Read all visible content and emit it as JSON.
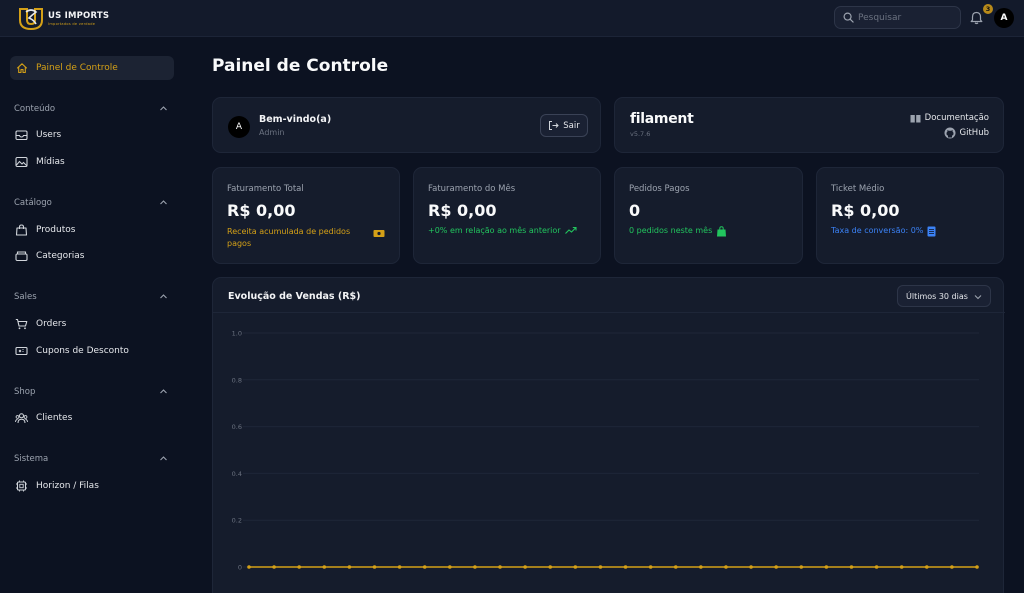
{
  "brand": {
    "name": "US IMPORTS",
    "tagline": "Importados de verdade"
  },
  "topbar": {
    "search_placeholder": "Pesquisar",
    "notification_count": "3",
    "avatar_initial": "A"
  },
  "sidebar": {
    "active": {
      "label": "Painel de Controle",
      "icon": "home-icon"
    },
    "groups": [
      {
        "label": "Conteúdo",
        "items": [
          {
            "label": "Users",
            "icon": "inbox-icon"
          },
          {
            "label": "Mídias",
            "icon": "image-icon"
          }
        ]
      },
      {
        "label": "Catálogo",
        "items": [
          {
            "label": "Produtos",
            "icon": "shopping-bag-icon"
          },
          {
            "label": "Categorias",
            "icon": "folder-icon"
          }
        ]
      },
      {
        "label": "Sales",
        "items": [
          {
            "label": "Orders",
            "icon": "cart-icon"
          },
          {
            "label": "Cupons de Desconto",
            "icon": "ticket-icon"
          }
        ]
      },
      {
        "label": "Shop",
        "items": [
          {
            "label": "Clientes",
            "icon": "users-icon"
          }
        ]
      },
      {
        "label": "Sistema",
        "items": [
          {
            "label": "Horizon / Filas",
            "icon": "cpu-chip-icon"
          }
        ]
      }
    ]
  },
  "page": {
    "title": "Painel de Controle"
  },
  "welcome": {
    "avatar_initial": "A",
    "title": "Bem-vindo(a)",
    "subtitle": "Admin",
    "logout_label": "Sair"
  },
  "filament": {
    "brand": "filament",
    "version": "v5.7.6",
    "docs_label": "Documentação",
    "github_label": "GitHub"
  },
  "stats": [
    {
      "label": "Faturamento Total",
      "value": "R$ 0,00",
      "description": "Receita acumulada de pedidos pagos",
      "color": "#d4a017",
      "icon": "banknotes-icon"
    },
    {
      "label": "Faturamento do Mês",
      "value": "R$ 0,00",
      "description": "+0% em relação ao mês anterior",
      "color": "#22c55e",
      "icon": "trending-up-icon"
    },
    {
      "label": "Pedidos Pagos",
      "value": "0",
      "description": "0 pedidos neste mês",
      "color": "#22c55e",
      "icon": "shopping-bag-icon"
    },
    {
      "label": "Ticket Médio",
      "value": "R$ 0,00",
      "description": "Taxa de conversão: 0%",
      "color": "#3b82f6",
      "icon": "document-icon"
    }
  ],
  "chart": {
    "title": "Evolução de Vendas (R$)",
    "range_label": "Últimos 30 dias"
  },
  "chart_data": {
    "type": "line",
    "title": "Evolução de Vendas (R$)",
    "xlabel": "",
    "ylabel": "",
    "ylim": [
      0,
      1
    ],
    "yticks": [
      "1.0",
      "0.8",
      "0.6",
      "0.4",
      "0.2",
      "0"
    ],
    "grid": true,
    "series": [
      {
        "values": [
          0,
          0,
          0,
          0,
          0,
          0,
          0,
          0,
          0,
          0,
          0,
          0,
          0,
          0,
          0,
          0,
          0,
          0,
          0,
          0,
          0,
          0,
          0,
          0,
          0,
          0,
          0,
          0,
          0,
          0
        ],
        "color": "#d4a017"
      }
    ]
  },
  "colors": {
    "accent": "#d4a017",
    "background": "#0c1221",
    "card": "#151c2c"
  }
}
